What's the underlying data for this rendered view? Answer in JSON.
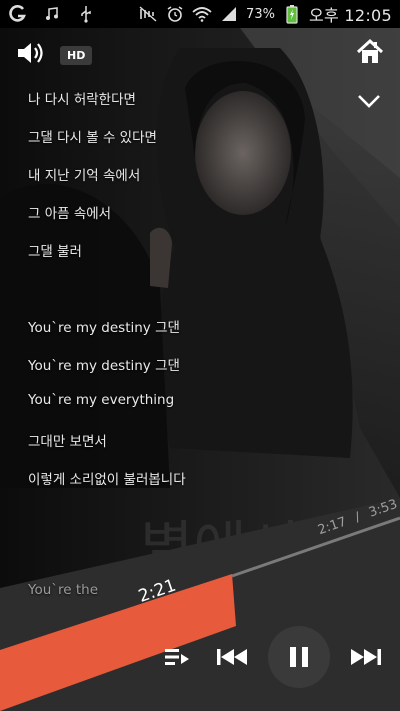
{
  "status_bar": {
    "battery_percent": "73%",
    "time": "오후 12:05",
    "icons": [
      "g-app-icon",
      "music-note-icon",
      "usb-icon",
      "mute-icon",
      "alarm-icon",
      "wifi-icon",
      "signal-icon",
      "battery-charging-icon"
    ]
  },
  "player": {
    "hd_label": "HD",
    "lyrics": [
      "나 다시 허락한다면",
      "그댈 다시 볼 수 있다면",
      "내 지난 기억 속에서",
      "그 아픔 속에서",
      "그댈 불러",
      "You`re my destiny 그댄",
      "You`re my destiny 그댄",
      "You`re my everything",
      "그대만 보면서",
      "이렇게 소리없이 불러봅니다",
      "You`re the"
    ],
    "current_time": "2:21",
    "elapsed_time": "2:17",
    "time_separator": "/",
    "total_time": "3:53",
    "progress_fraction": 0.59,
    "accent_color": "#e85a3c"
  }
}
